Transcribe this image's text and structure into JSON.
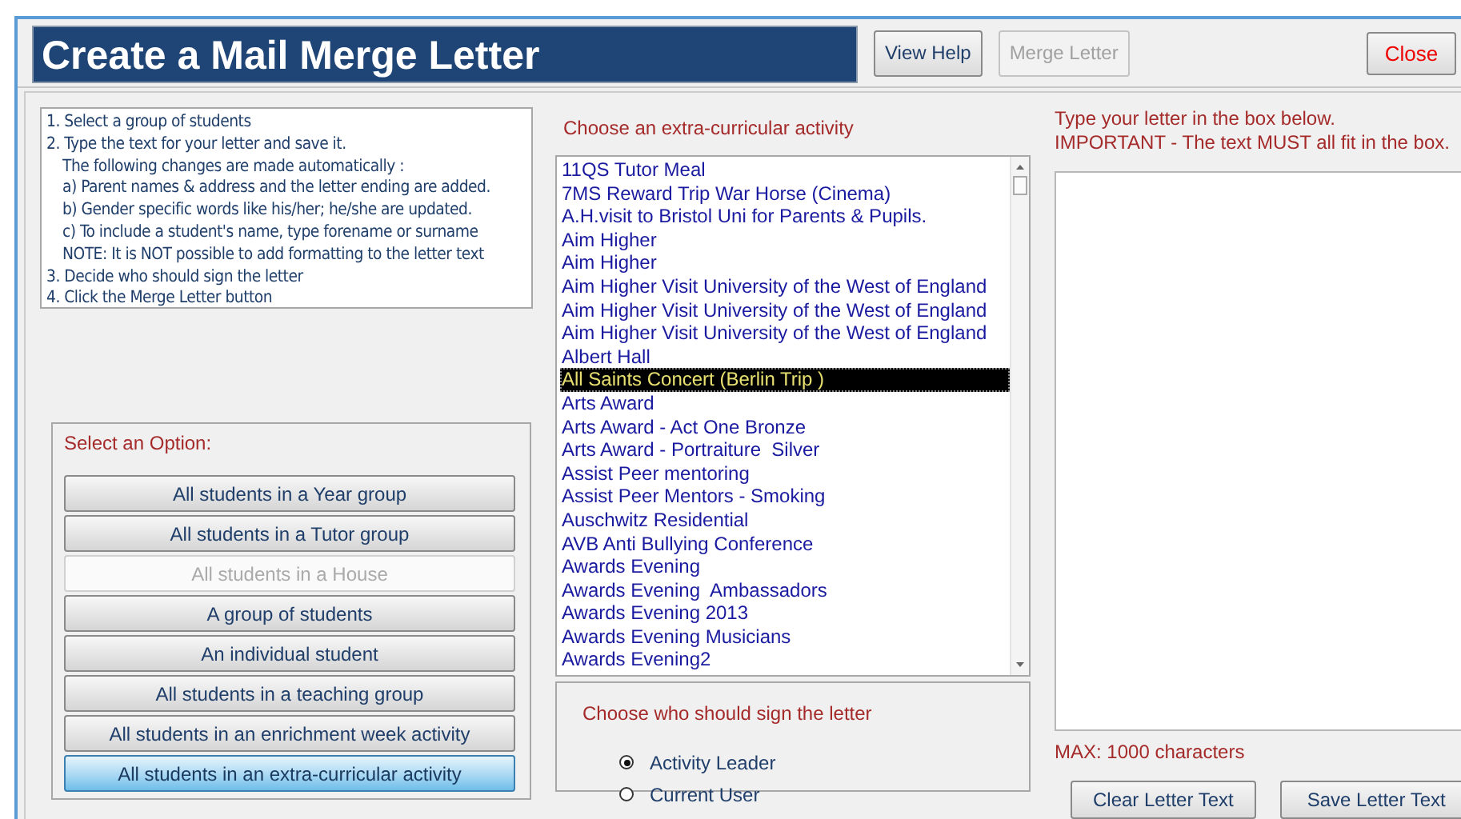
{
  "window": {
    "title": "Create a Mail Merge Letter"
  },
  "toolbar": [
    {
      "label": "View Help",
      "disabled": false
    },
    {
      "label": "Merge Letter",
      "disabled": true
    }
  ],
  "close_button": {
    "label": "Close"
  },
  "instructions": [
    "1. Select a group of students",
    "2. Type the text for your letter and save it.",
    "The following changes are made automatically :",
    "a) Parent names & address and the letter ending are added.",
    "b) Gender specific words like his/her; he/she are updated.",
    "c) To include a student's name, type forename or surname",
    "NOTE: It is NOT possible to add formatting to the letter text",
    "3. Decide who should sign the letter",
    "4. Click the Merge Letter button"
  ],
  "options": {
    "title": "Select an Option:",
    "items": [
      {
        "label": "All students in a Year group",
        "disabled": false,
        "selected": false
      },
      {
        "label": "All students in a Tutor group",
        "disabled": false,
        "selected": false
      },
      {
        "label": "All students in a House",
        "disabled": true,
        "selected": false
      },
      {
        "label": "A group of students",
        "disabled": false,
        "selected": false
      },
      {
        "label": "An individual student",
        "disabled": false,
        "selected": false
      },
      {
        "label": "All students in a teaching group",
        "disabled": false,
        "selected": false
      },
      {
        "label": "All students in an enrichment week activity",
        "disabled": false,
        "selected": false
      },
      {
        "label": "All students in an extra-curricular activity",
        "disabled": false,
        "selected": true
      }
    ]
  },
  "activities": {
    "title": "Choose an extra-curricular activity",
    "items": [
      {
        "label": "11QS Tutor Meal",
        "selected": false
      },
      {
        "label": "7MS Reward Trip War Horse (Cinema)",
        "selected": false
      },
      {
        "label": "A.H.visit to Bristol Uni for Parents & Pupils.",
        "selected": false
      },
      {
        "label": "Aim Higher",
        "selected": false
      },
      {
        "label": "Aim Higher",
        "selected": false
      },
      {
        "label": "Aim Higher Visit University of the West of England",
        "selected": false
      },
      {
        "label": "Aim Higher Visit University of the West of England",
        "selected": false
      },
      {
        "label": "Aim Higher Visit University of the West of England",
        "selected": false
      },
      {
        "label": "Albert Hall",
        "selected": false
      },
      {
        "label": "All Saints Concert (Berlin Trip )",
        "selected": true
      },
      {
        "label": "Arts Award",
        "selected": false
      },
      {
        "label": "Arts Award - Act One Bronze",
        "selected": false
      },
      {
        "label": "Arts Award - Portraiture  Silver",
        "selected": false
      },
      {
        "label": "Assist Peer mentoring",
        "selected": false
      },
      {
        "label": "Assist Peer Mentors - Smoking",
        "selected": false
      },
      {
        "label": "Auschwitz Residential",
        "selected": false
      },
      {
        "label": "AVB Anti Bullying Conference",
        "selected": false
      },
      {
        "label": "Awards Evening",
        "selected": false
      },
      {
        "label": "Awards Evening  Ambassadors",
        "selected": false
      },
      {
        "label": "Awards Evening 2013",
        "selected": false
      },
      {
        "label": "Awards Evening Musicians",
        "selected": false
      },
      {
        "label": "Awards Evening2",
        "selected": false
      }
    ]
  },
  "signer": {
    "title": "Choose who should sign the letter",
    "options": [
      {
        "label": "Activity Leader",
        "selected": true
      },
      {
        "label": "Current User",
        "selected": false
      }
    ]
  },
  "letter": {
    "hint": "Type your letter in the box below.",
    "warning": "IMPORTANT - The text MUST all fit in the box.",
    "limit": "MAX: 1000 characters"
  },
  "letter_buttons": [
    "Clear Letter Text",
    "Save Letter Text"
  ]
}
